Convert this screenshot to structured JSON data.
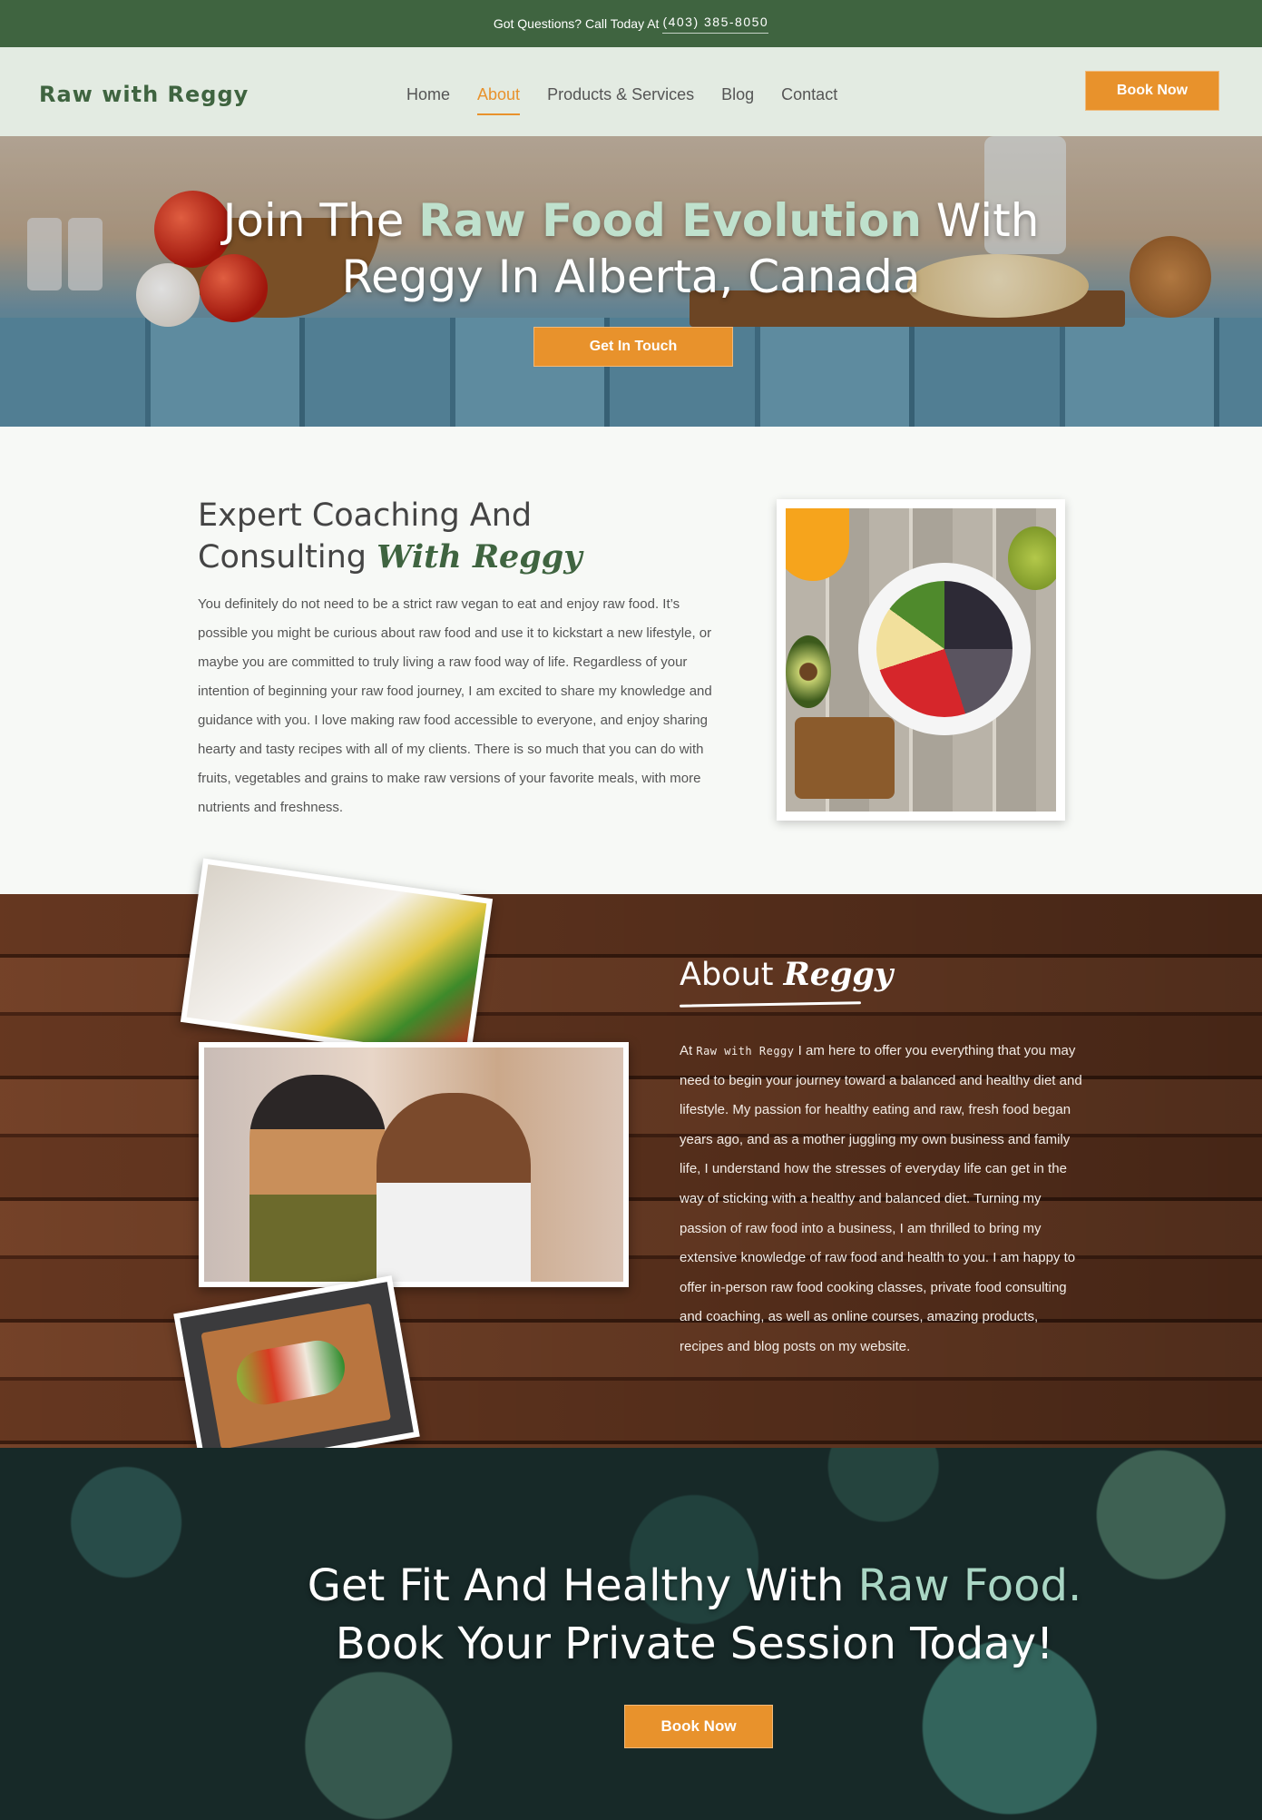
{
  "topbar": {
    "text": "Got Questions? Call Today At",
    "phone": "(403) 385-8050"
  },
  "header": {
    "logo": "Raw with Reggy",
    "nav": [
      "Home",
      "About",
      "Products & Services",
      "Blog",
      "Contact"
    ],
    "active_nav": "About",
    "book_label": "Book Now"
  },
  "hero": {
    "title_part1": "Join The ",
    "title_accent": "Raw Food Evolution",
    "title_part2": " With",
    "title_line2": "Reggy  In Alberta, Canada",
    "cta_label": "Get In Touch"
  },
  "expert": {
    "heading_line1": "Expert Coaching And",
    "heading_line2": "Consulting ",
    "heading_script": "With Reggy",
    "body": "You definitely do not need to be a strict raw vegan to eat and enjoy raw food. It’s possible you might be curious about raw food and use it to kickstart a new lifestyle, or maybe you are committed to truly living a raw food way of life. Regardless of your intention of beginning your raw food journey, I am excited to share my knowledge and guidance with you. I love making raw food accessible to everyone, and enjoy sharing hearty and tasty recipes with all of my clients. There is so much that you can do with fruits, vegetables and grains to make raw versions of your favorite meals, with more nutrients and freshness."
  },
  "about": {
    "heading": "About ",
    "heading_script": "Reggy",
    "body_prefix": "At ",
    "brand": "Raw with Reggy",
    "body": " I am here to offer you everything that you may need to begin your journey toward a balanced and healthy diet and lifestyle. My passion for healthy eating and raw, fresh food began years ago, and as a mother juggling my own business and family life, I understand how the stresses of everyday life can get in the way of sticking with a healthy and balanced diet. Turning my passion of raw food into a business, I am thrilled to bring my extensive knowledge of raw food and health to you. I am happy to offer in-person raw food cooking classes, private food consulting and coaching, as well as online courses, amazing products, recipes and blog posts on my website."
  },
  "cta": {
    "line1_part1": "Get Fit And Healthy With ",
    "line1_accent": "Raw Food.",
    "line2": "Book Your Private Session Today!",
    "book_label": "Book Now"
  },
  "colors": {
    "brand_green": "#3f6440",
    "accent_orange": "#e8922c",
    "accent_mint": "#bfe1cd"
  }
}
